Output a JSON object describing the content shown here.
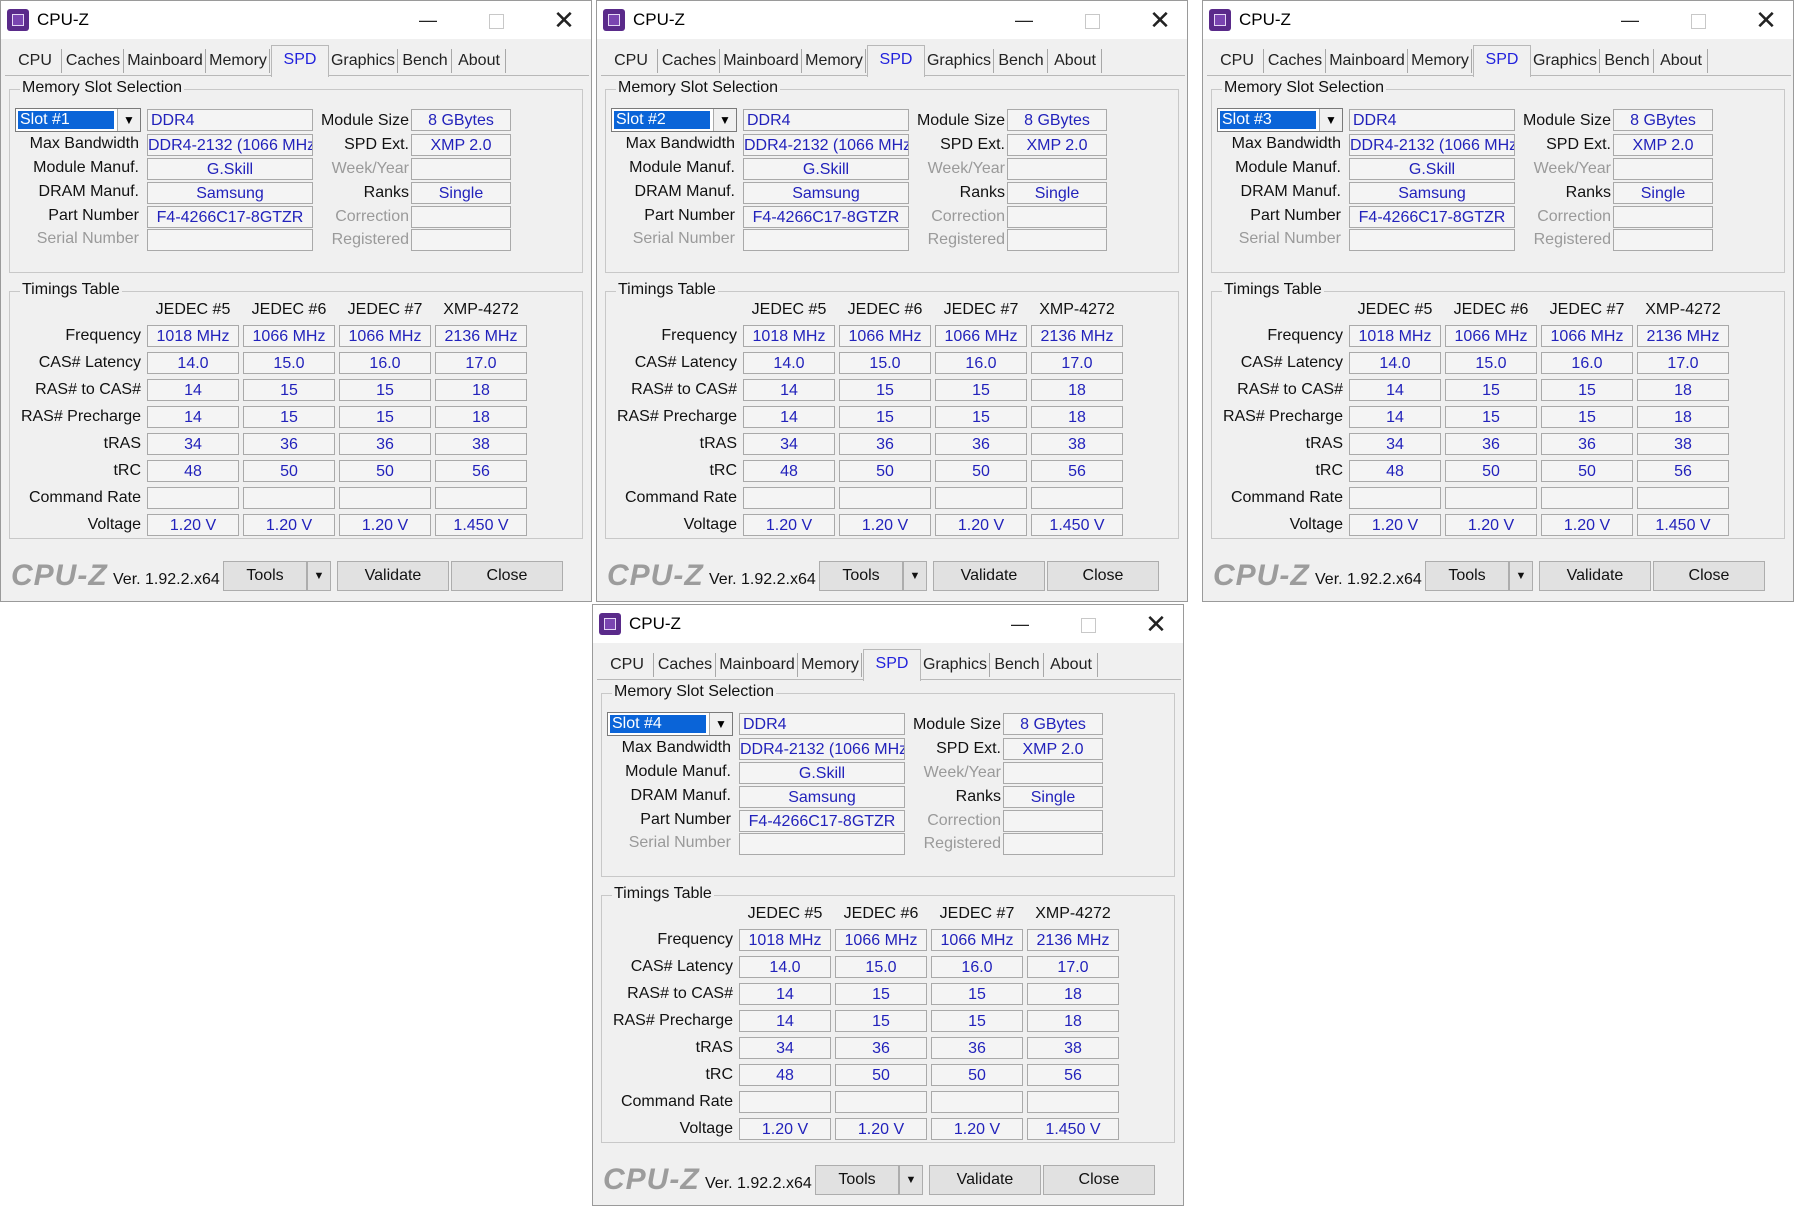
{
  "app": {
    "title": "CPU-Z",
    "tabs": [
      "CPU",
      "Caches",
      "Mainboard",
      "Memory",
      "SPD",
      "Graphics",
      "Bench",
      "About"
    ],
    "active_tab": "SPD",
    "groups": {
      "slot": "Memory Slot Selection",
      "timings": "Timings Table"
    },
    "labels": {
      "max_bandwidth": "Max Bandwidth",
      "module_manuf": "Module Manuf.",
      "dram_manuf": "DRAM Manuf.",
      "part_number": "Part Number",
      "serial_number": "Serial Number",
      "module_size": "Module Size",
      "spd_ext": "SPD Ext.",
      "week_year": "Week/Year",
      "ranks": "Ranks",
      "correction": "Correction",
      "registered": "Registered"
    },
    "timing_columns": [
      "JEDEC #5",
      "JEDEC #6",
      "JEDEC #7",
      "XMP-4272"
    ],
    "timing_rows": [
      {
        "label": "Frequency",
        "values": [
          "1018 MHz",
          "1066 MHz",
          "1066 MHz",
          "2136 MHz"
        ]
      },
      {
        "label": "CAS# Latency",
        "values": [
          "14.0",
          "15.0",
          "16.0",
          "17.0"
        ]
      },
      {
        "label": "RAS# to CAS#",
        "values": [
          "14",
          "15",
          "15",
          "18"
        ]
      },
      {
        "label": "RAS# Precharge",
        "values": [
          "14",
          "15",
          "15",
          "18"
        ]
      },
      {
        "label": "tRAS",
        "values": [
          "34",
          "36",
          "36",
          "38"
        ]
      },
      {
        "label": "tRC",
        "values": [
          "48",
          "50",
          "50",
          "56"
        ]
      },
      {
        "label": "Command Rate",
        "values": [
          "",
          "",
          "",
          ""
        ]
      },
      {
        "label": "Voltage",
        "values": [
          "1.20 V",
          "1.20 V",
          "1.20 V",
          "1.450 V"
        ]
      }
    ],
    "module": {
      "type": "DDR4",
      "max_bandwidth": "DDR4-2132 (1066 MHz)",
      "module_manuf": "G.Skill",
      "dram_manuf": "Samsung",
      "part_number": "F4-4266C17-8GTZR",
      "serial_number": "",
      "module_size": "8 GBytes",
      "spd_ext": "XMP 2.0",
      "week_year": "",
      "ranks": "Single",
      "correction": "",
      "registered": ""
    },
    "footer": {
      "brand": "CPU-Z",
      "version": "Ver. 1.92.2.x64",
      "tools": "Tools",
      "tools_arrow": "▼",
      "validate": "Validate",
      "close": "Close"
    },
    "window_controls": {
      "minimize": "—",
      "close": "✕"
    }
  },
  "windows": [
    {
      "slot": "Slot #1"
    },
    {
      "slot": "Slot #2"
    },
    {
      "slot": "Slot #3"
    },
    {
      "slot": "Slot #4"
    }
  ]
}
